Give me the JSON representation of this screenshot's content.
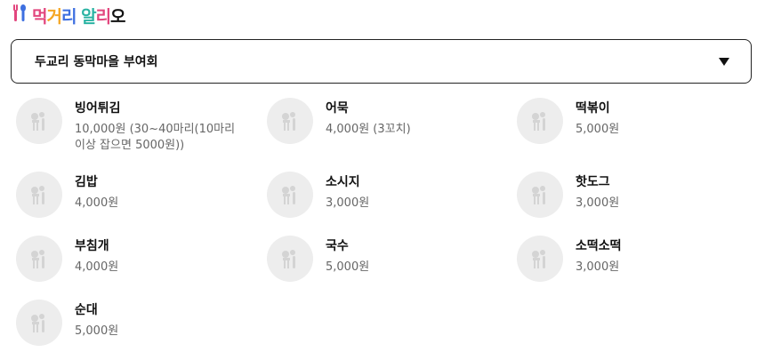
{
  "brand": {
    "name": "먹거리 알리오"
  },
  "selector": {
    "selected": "두교리 동막마을 부여회"
  },
  "menu": [
    {
      "name": "빙어튀김",
      "price": "10,000원 (30~40마리(10마리 이상 잡으면 5000원))"
    },
    {
      "name": "어묵",
      "price": "4,000원 (3꼬치)"
    },
    {
      "name": "떡볶이",
      "price": "5,000원"
    },
    {
      "name": "김밥",
      "price": "4,000원"
    },
    {
      "name": "소시지",
      "price": "3,000원"
    },
    {
      "name": "핫도그",
      "price": "3,000원"
    },
    {
      "name": "부침개",
      "price": "4,000원"
    },
    {
      "name": "국수",
      "price": "5,000원"
    },
    {
      "name": "소떡소떡",
      "price": "3,000원"
    },
    {
      "name": "순대",
      "price": "5,000원"
    }
  ]
}
